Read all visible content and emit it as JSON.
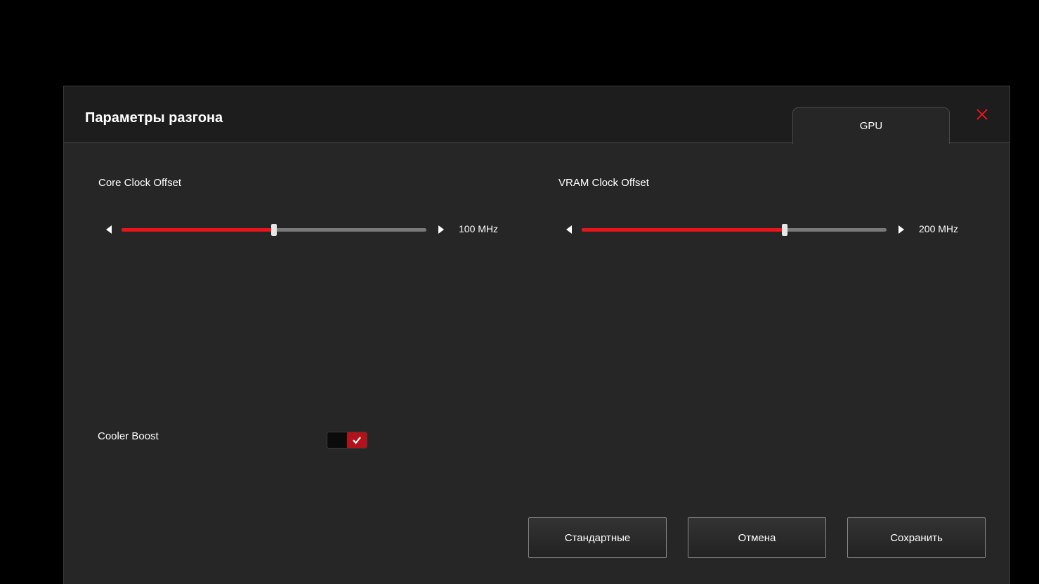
{
  "dialog": {
    "title": "Параметры разгона",
    "tab_label": "GPU"
  },
  "core_clock": {
    "label": "Core Clock Offset",
    "value_text": "100 MHz",
    "fill_fraction": 0.5
  },
  "vram_clock": {
    "label": "VRAM Clock Offset",
    "value_text": "200 MHz",
    "fill_fraction": 0.665
  },
  "cooler_boost": {
    "label": "Cooler Boost",
    "enabled": true
  },
  "buttons": {
    "default_label": "Стандартные",
    "cancel_label": "Отмена",
    "save_label": "Сохранить"
  },
  "colors": {
    "accent": "#e8151b",
    "toggle_on": "#b3121a",
    "background": "#262626",
    "header": "#1d1d1d"
  },
  "icons": {
    "close": "close-icon",
    "left_arrow": "triangle-left-icon",
    "right_arrow": "triangle-right-icon",
    "check": "checkmark-icon"
  }
}
